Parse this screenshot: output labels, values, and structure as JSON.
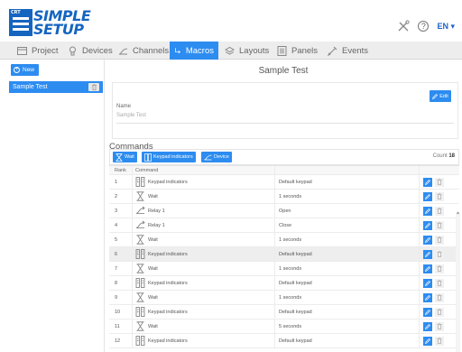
{
  "app": {
    "logo_small": "CRT",
    "logo_line1": "SIMPLE",
    "logo_line2": "SETUP",
    "help_symbol": "?",
    "language": "EN",
    "language_caret": "▾"
  },
  "nav": {
    "items": [
      {
        "label": "Project",
        "icon": "project-icon"
      },
      {
        "label": "Devices",
        "icon": "devices-icon"
      },
      {
        "label": "Channels",
        "icon": "channels-icon"
      },
      {
        "label": "Macros",
        "icon": "macros-icon",
        "active": true
      },
      {
        "label": "Layouts",
        "icon": "layouts-icon"
      },
      {
        "label": "Panels",
        "icon": "panels-icon"
      },
      {
        "label": "Events",
        "icon": "events-icon"
      }
    ]
  },
  "sidebar": {
    "new_label": "New",
    "macros": [
      {
        "label": "Sample Test",
        "selected": true
      }
    ]
  },
  "main": {
    "title": "Sample Test",
    "edit_label": "Edit",
    "name_label": "Name",
    "name_value": "Sample Test",
    "commands_label": "Commands",
    "buttons": {
      "wait": "Wait",
      "keypad": "Keypad indicators",
      "device": "Device"
    },
    "count_label": "Count",
    "count_value": "18",
    "columns": {
      "rank": "Rank",
      "command": "Command"
    },
    "rows": [
      {
        "rank": "1",
        "command": "Keypad indicators",
        "type": "keypad",
        "value": "Default keypad"
      },
      {
        "rank": "2",
        "command": "Wait",
        "type": "wait",
        "value": "1 seconds"
      },
      {
        "rank": "3",
        "command": "Relay 1",
        "type": "relay",
        "value": "Open"
      },
      {
        "rank": "4",
        "command": "Relay 1",
        "type": "relay",
        "value": "Close"
      },
      {
        "rank": "5",
        "command": "Wait",
        "type": "wait",
        "value": "1 seconds"
      },
      {
        "rank": "6",
        "command": "Keypad indicators",
        "type": "keypad",
        "value": "Default keypad",
        "highlight": true
      },
      {
        "rank": "7",
        "command": "Wait",
        "type": "wait",
        "value": "1 seconds"
      },
      {
        "rank": "8",
        "command": "Keypad indicators",
        "type": "keypad",
        "value": "Default keypad"
      },
      {
        "rank": "9",
        "command": "Wait",
        "type": "wait",
        "value": "1 seconds"
      },
      {
        "rank": "10",
        "command": "Keypad indicators",
        "type": "keypad",
        "value": "Default keypad"
      },
      {
        "rank": "11",
        "command": "Wait",
        "type": "wait",
        "value": "5 seconds"
      },
      {
        "rank": "12",
        "command": "Keypad indicators",
        "type": "keypad",
        "value": "Default keypad"
      }
    ]
  },
  "colors": {
    "accent": "#2d8cf0",
    "brand": "#1565c0",
    "nav_bg": "#ededed"
  }
}
